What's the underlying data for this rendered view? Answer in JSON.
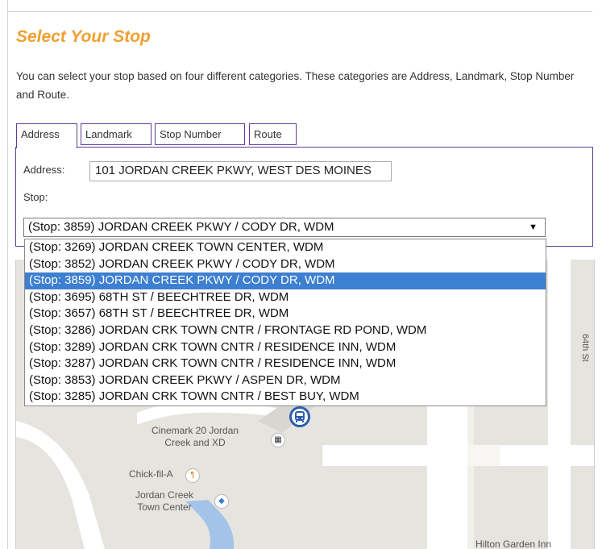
{
  "header": {
    "title": "Select Your Stop",
    "intro": "You can select your stop based on four different categories. These categories are Address, Landmark, Stop Number and Route."
  },
  "tabs": [
    {
      "label": "Address",
      "active": true
    },
    {
      "label": "Landmark",
      "active": false
    },
    {
      "label": "Stop Number",
      "active": false
    },
    {
      "label": "Route",
      "active": false
    }
  ],
  "form": {
    "address_label": "Address:",
    "address_value": "101 JORDAN CREEK PKWY, WEST DES MOINES",
    "stop_label": "Stop:",
    "stop_selected": "(Stop: 3859) JORDAN CREEK PKWY / CODY DR, WDM",
    "select_arrow": "▼"
  },
  "dropdown": {
    "options": [
      "(Stop: 3269) JORDAN CREEK TOWN CENTER, WDM",
      "(Stop: 3852) JORDAN CREEK PKWY / CODY DR, WDM",
      "(Stop: 3859) JORDAN CREEK PKWY / CODY DR, WDM",
      "(Stop: 3695) 68TH ST / BEECHTREE DR, WDM",
      "(Stop: 3657) 68TH ST / BEECHTREE DR, WDM",
      "(Stop: 3286) JORDAN CRK TOWN CNTR / FRONTAGE RD POND, WDM",
      "(Stop: 3289) JORDAN CRK TOWN CNTR / RESIDENCE INN, WDM",
      "(Stop: 3287) JORDAN CRK TOWN CNTR / RESIDENCE INN, WDM",
      "(Stop: 3853) JORDAN CREEK PKWY / ASPEN DR, WDM",
      "(Stop: 3285) JORDAN CRK TOWN CNTR / BEST BUY, WDM"
    ],
    "selected_index": 2
  },
  "map": {
    "labels": {
      "cinemark": "Cinemark 20 Jordan\nCreek and XD",
      "chickfila": "Chick-fil-A",
      "town_center": "Jordan Creek\nTown Center",
      "hilton": "Hilton Garden Inn",
      "street_64th": "64th St"
    },
    "colors": {
      "background": "#e6e4df",
      "road": "#ffffff",
      "water": "#a3c4e8",
      "bus_marker": "#2a5db0"
    },
    "icons": [
      "bus-stop-icon",
      "movie-theater-icon",
      "restaurant-icon",
      "shopping-icon"
    ]
  }
}
